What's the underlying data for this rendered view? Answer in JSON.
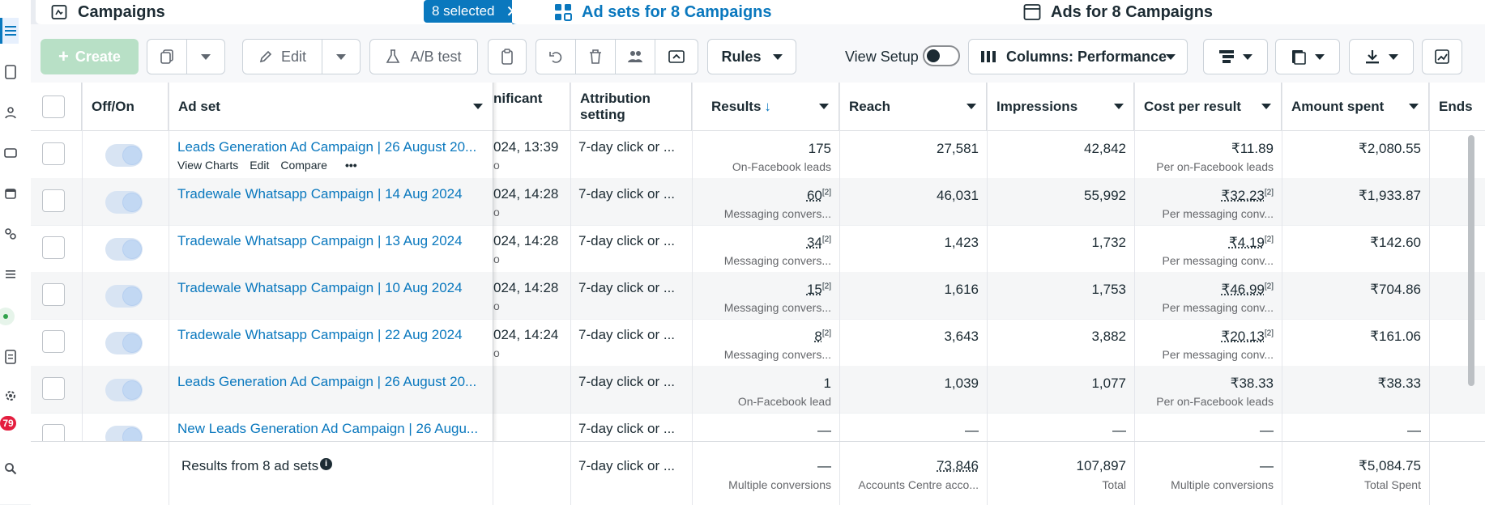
{
  "tabs": {
    "campaigns": "Campaigns",
    "selected_chip": "8 selected",
    "adsets": "Ad sets for 8 Campaigns",
    "ads": "Ads for 8 Campaigns"
  },
  "sidebar": {
    "badge": "79"
  },
  "toolbar": {
    "create": "Create",
    "edit": "Edit",
    "ab_test": "A/B test",
    "rules": "Rules",
    "view_setup": "View Setup",
    "columns": "Columns: Performance"
  },
  "table": {
    "headers": {
      "off_on": "Off/On",
      "ad_set": "Ad set",
      "significant": "nificant",
      "attribution": "Attribution setting",
      "results": "Results",
      "reach": "Reach",
      "impressions": "Impressions",
      "cost_per_result": "Cost per result",
      "amount_spent": "Amount spent",
      "ends": "Ends"
    },
    "row_actions": [
      "View Charts",
      "Edit",
      "Compare",
      "•••"
    ],
    "rows": [
      {
        "name": "Leads Generation Ad Campaign | 26 August 20...",
        "sig": "024, 13:39",
        "sig2": "o",
        "attr": "7-day click or ...",
        "results": "175",
        "results_sub": "On-Facebook leads",
        "reach": "27,581",
        "impressions": "42,842",
        "cpr": "₹11.89",
        "cpr_sub": "Per on-Facebook leads",
        "spent": "₹2,080.55"
      },
      {
        "name": "Tradewale Whatsapp Campaign | 14 Aug 2024",
        "sig": "024, 14:28",
        "sig2": "o",
        "attr": "7-day click or ...",
        "results": "60",
        "results_sup": "[2]",
        "results_sub": "Messaging convers...",
        "reach": "46,031",
        "impressions": "55,992",
        "cpr": "₹32.23",
        "cpr_sup": "[2]",
        "cpr_sub": "Per messaging conv...",
        "spent": "₹1,933.87"
      },
      {
        "name": "Tradewale Whatsapp Campaign | 13 Aug 2024",
        "sig": "024, 14:28",
        "sig2": "o",
        "attr": "7-day click or ...",
        "results": "34",
        "results_sup": "[2]",
        "results_sub": "Messaging convers...",
        "reach": "1,423",
        "impressions": "1,732",
        "cpr": "₹4.19",
        "cpr_sup": "[2]",
        "cpr_sub": "Per messaging conv...",
        "spent": "₹142.60"
      },
      {
        "name": "Tradewale Whatsapp Campaign | 10 Aug 2024",
        "sig": "024, 14:28",
        "sig2": "o",
        "attr": "7-day click or ...",
        "results": "15",
        "results_sup": "[2]",
        "results_sub": "Messaging convers...",
        "reach": "1,616",
        "impressions": "1,753",
        "cpr": "₹46.99",
        "cpr_sup": "[2]",
        "cpr_sub": "Per messaging conv...",
        "spent": "₹704.86"
      },
      {
        "name": "Tradewale Whatsapp Campaign | 22 Aug 2024",
        "sig": "024, 14:24",
        "sig2": "o",
        "attr": "7-day click or ...",
        "results": "8",
        "results_sup": "[2]",
        "results_sub": "Messaging convers...",
        "reach": "3,643",
        "impressions": "3,882",
        "cpr": "₹20.13",
        "cpr_sup": "[2]",
        "cpr_sub": "Per messaging conv...",
        "spent": "₹161.06"
      },
      {
        "name": "Leads Generation Ad Campaign | 26 August 20...",
        "sig": "",
        "sig2": "",
        "attr": "7-day click or ...",
        "results": "1",
        "results_sub": "On-Facebook lead",
        "reach": "1,039",
        "impressions": "1,077",
        "cpr": "₹38.33",
        "cpr_sub": "Per on-Facebook leads",
        "spent": "₹38.33"
      },
      {
        "name": "New Leads Generation Ad Campaign | 26 Augu...",
        "sig": "",
        "sig2": "",
        "attr": "7-day click or ...",
        "results": "—",
        "results_sub": "",
        "reach": "—",
        "impressions": "—",
        "cpr": "—",
        "cpr_sub": "",
        "spent": "—"
      }
    ],
    "footer": {
      "label": "Results from 8 ad sets",
      "attr": "7-day click or ...",
      "results": "—",
      "results_sub": "Multiple conversions",
      "reach": "73,846",
      "reach_sub": "Accounts Centre acco...",
      "impressions": "107,897",
      "impressions_sub": "Total",
      "cpr": "—",
      "cpr_sub": "Multiple conversions",
      "spent": "₹5,084.75",
      "spent_sub": "Total Spent"
    }
  },
  "colors": {
    "accent": "#0a78be",
    "create_disabled": "#b8e0c6",
    "badge": "#e41e3f"
  }
}
